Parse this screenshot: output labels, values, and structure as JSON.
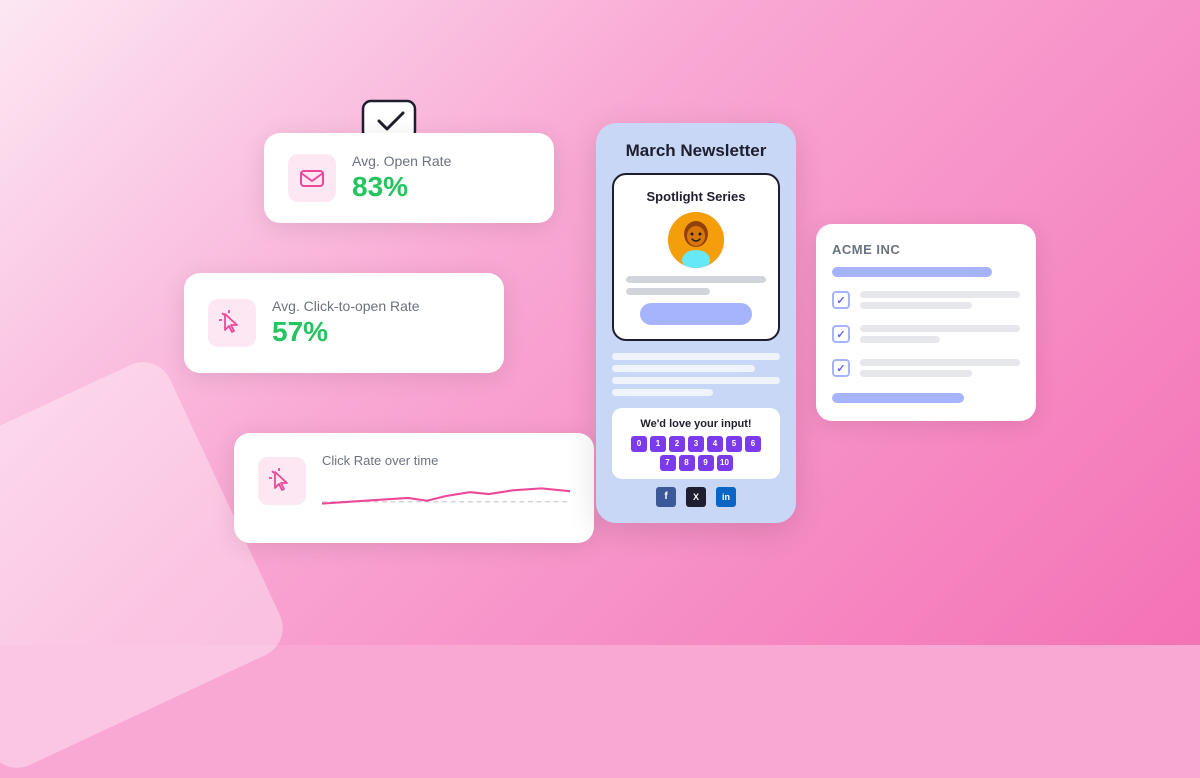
{
  "background": {
    "color": "#f9a8d4"
  },
  "check_bubble": {
    "label": "check-icon"
  },
  "cards": {
    "open_rate": {
      "label": "Avg. Open Rate",
      "value": "83%",
      "icon_label": "envelope-icon"
    },
    "cto_rate": {
      "label": "Avg. Click-to-open Rate",
      "value": "57%",
      "icon_label": "cursor-icon"
    },
    "click_over_time": {
      "title": "Click Rate over time",
      "icon_label": "cursor-icon"
    }
  },
  "newsletter": {
    "title": "March Newsletter",
    "spotlight": {
      "label": "Spotlight Series"
    },
    "survey": {
      "title": "We'd love your input!",
      "scale": [
        "0",
        "1",
        "2",
        "3",
        "4",
        "5",
        "6",
        "7",
        "8",
        "9",
        "10"
      ]
    },
    "social": {
      "icons": [
        "f",
        "X",
        "in"
      ]
    }
  },
  "right_panel": {
    "company": "ACME INC",
    "rows": [
      {
        "checked": true
      },
      {
        "checked": true
      },
      {
        "checked": true
      }
    ]
  }
}
